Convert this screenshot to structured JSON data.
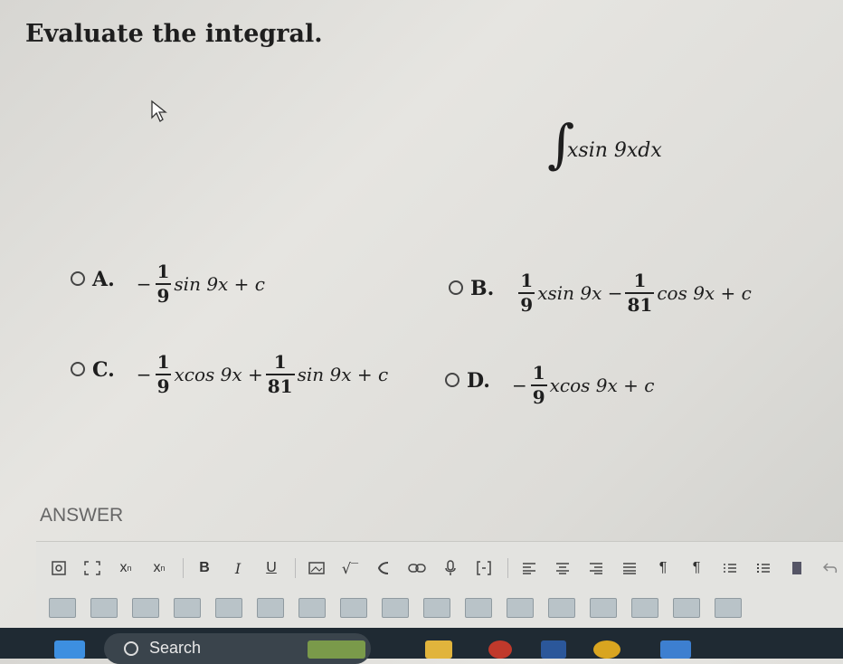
{
  "question": {
    "title": "Evaluate the integral."
  },
  "integral": {
    "sign": "∫",
    "integrand": "xsin 9xdx"
  },
  "options": {
    "a": {
      "letter": "A.",
      "minus": "−",
      "f1_num": "1",
      "f1_den": "9",
      "t1": "sin 9x + c"
    },
    "b": {
      "letter": "B.",
      "f1_num": "1",
      "f1_den": "9",
      "t1": "xsin 9x −",
      "f2_num": "1",
      "f2_den": "81",
      "t2": "cos 9x + c"
    },
    "c": {
      "letter": "C.",
      "minus": "−",
      "f1_num": "1",
      "f1_den": "9",
      "t1": "xcos 9x +",
      "f2_num": "1",
      "f2_den": "81",
      "t2": "sin 9x + c"
    },
    "d": {
      "letter": "D.",
      "minus": "−",
      "f1_num": "1",
      "f1_den": "9",
      "t1": "xcos 9x + c"
    }
  },
  "answer": {
    "label": "ANSWER"
  },
  "toolbar": {
    "subscript": "x",
    "superscript": "x",
    "bold": "B",
    "italic": "I",
    "underline": "U",
    "sqrt": "√‾",
    "paragraph": "¶"
  },
  "taskbar": {
    "search_label": "Search"
  }
}
